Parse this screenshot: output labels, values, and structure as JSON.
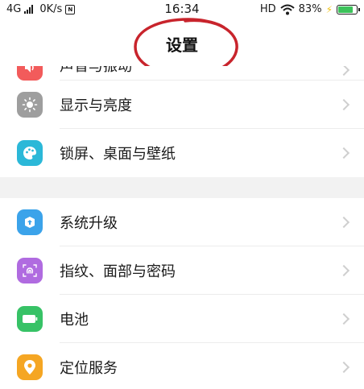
{
  "status_bar": {
    "network": "4G",
    "speed": "0K/s",
    "time": "16:34",
    "hd": "HD",
    "battery_percent_text": "83%",
    "battery_level": 0.83
  },
  "header": {
    "title": "设置"
  },
  "settings": {
    "items": [
      {
        "label": "声音与振动",
        "icon": "speaker-icon",
        "color": "#f25b5b"
      },
      {
        "label": "显示与亮度",
        "icon": "brightness-icon",
        "color": "#9e9e9e"
      },
      {
        "label": "锁屏、桌面与壁纸",
        "icon": "palette-icon",
        "color": "#2bb8d8"
      },
      {
        "label": "系统升级",
        "icon": "upgrade-icon",
        "color": "#3ba3ea"
      },
      {
        "label": "指纹、面部与密码",
        "icon": "fingerprint-icon",
        "color": "#b06be0"
      },
      {
        "label": "电池",
        "icon": "battery-icon",
        "color": "#37c266"
      },
      {
        "label": "定位服务",
        "icon": "location-icon",
        "color": "#f5a623"
      }
    ]
  }
}
